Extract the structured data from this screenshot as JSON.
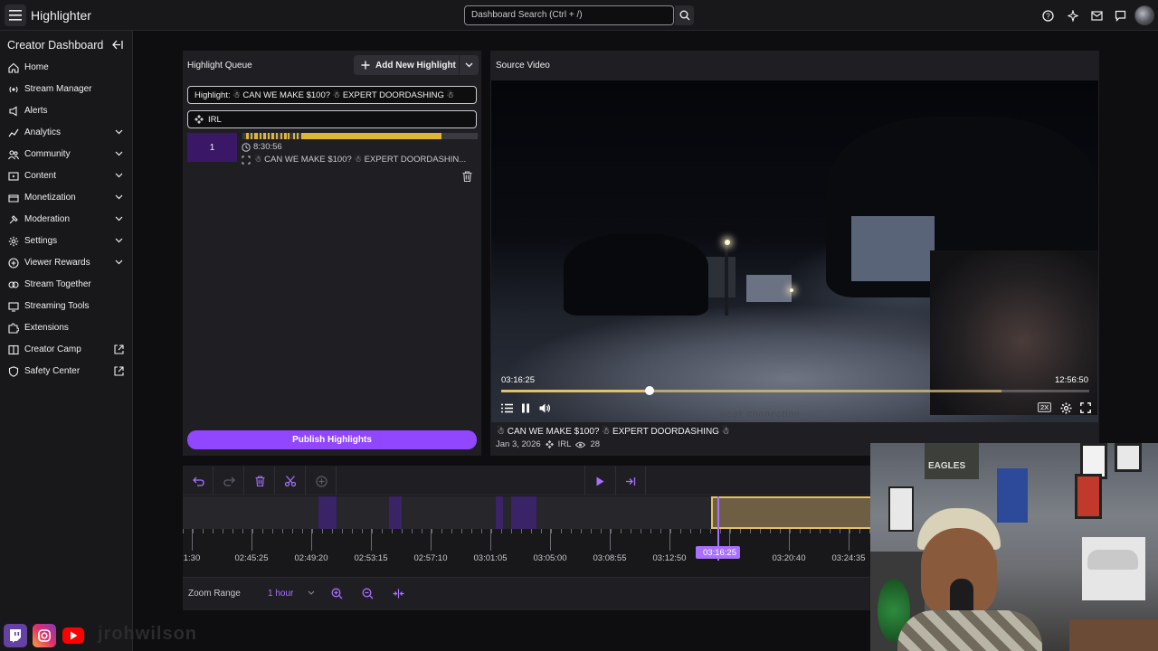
{
  "app": {
    "title": "Highlighter"
  },
  "search": {
    "placeholder": "Dashboard Search (Ctrl + /)"
  },
  "sidebar": {
    "title": "Creator Dashboard",
    "items": [
      {
        "label": "Home",
        "icon": "home-icon",
        "chevron": false,
        "external": false
      },
      {
        "label": "Stream Manager",
        "icon": "stream-manager-icon",
        "chevron": false,
        "external": false
      },
      {
        "label": "Alerts",
        "icon": "alerts-icon",
        "chevron": false,
        "external": false
      },
      {
        "label": "Analytics",
        "icon": "analytics-icon",
        "chevron": true,
        "external": false
      },
      {
        "label": "Community",
        "icon": "community-icon",
        "chevron": true,
        "external": false
      },
      {
        "label": "Content",
        "icon": "content-icon",
        "chevron": true,
        "external": false
      },
      {
        "label": "Monetization",
        "icon": "monetization-icon",
        "chevron": true,
        "external": false
      },
      {
        "label": "Moderation",
        "icon": "moderation-icon",
        "chevron": true,
        "external": false
      },
      {
        "label": "Settings",
        "icon": "settings-icon",
        "chevron": true,
        "external": false
      },
      {
        "label": "Viewer Rewards",
        "icon": "viewer-rewards-icon",
        "chevron": true,
        "external": false
      },
      {
        "label": "Stream Together",
        "icon": "stream-together-icon",
        "chevron": false,
        "external": false
      },
      {
        "label": "Streaming Tools",
        "icon": "streaming-tools-icon",
        "chevron": false,
        "external": false
      },
      {
        "label": "Extensions",
        "icon": "extensions-icon",
        "chevron": false,
        "external": false
      },
      {
        "label": "Creator Camp",
        "icon": "creator-camp-icon",
        "chevron": false,
        "external": true
      },
      {
        "label": "Safety Center",
        "icon": "safety-center-icon",
        "chevron": false,
        "external": true
      }
    ]
  },
  "queue": {
    "title": "Highlight Queue",
    "add_label": "Add New Highlight",
    "highlight_field": "Highlight: ☃ CAN WE MAKE $100? ☃ EXPERT DOORDASHING ☃",
    "category": "IRL",
    "clip": {
      "number": "1",
      "duration": "8:30:56",
      "title": "☃ CAN WE MAKE $100? ☃ EXPERT DOORDASHIN..."
    },
    "publish_label": "Publish Highlights"
  },
  "video": {
    "title": "Source Video",
    "current_time": "03:16:25",
    "total_time": "12:56:50",
    "progress": 0.252,
    "buffered": 0.85,
    "speed_badge": "2X",
    "watermark": "weak connection",
    "caption": "☃ CAN WE MAKE $100? ☃ EXPERT DOORDASHING ☃",
    "date": "Jan 3, 2026",
    "category": "IRL",
    "views": "28"
  },
  "timeline": {
    "ticks": [
      "1:30",
      "02:45:25",
      "02:49:20",
      "02:53:15",
      "02:57:10",
      "03:01:05",
      "03:05:00",
      "03:08:55",
      "03:12:50",
      "03:16:25",
      "03:20:40",
      "03:24:35"
    ],
    "playhead": "03:16:25",
    "zoom_label": "Zoom Range",
    "zoom_value": "1 hour"
  },
  "footer": {
    "handle": "jrohwilson"
  },
  "colors": {
    "accent": "#9147ff",
    "gold": "#e3c264",
    "bg": "#0e0e10"
  }
}
